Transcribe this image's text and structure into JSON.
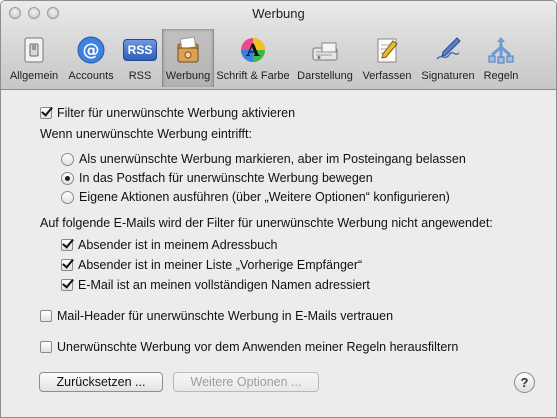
{
  "window": {
    "title": "Werbung"
  },
  "toolbar": {
    "items": [
      {
        "label": "Allgemein",
        "icon": "light-switch-icon"
      },
      {
        "label": "Accounts",
        "icon": "at-sign-icon"
      },
      {
        "label": "RSS",
        "icon": "rss-icon",
        "icon_text": "RSS"
      },
      {
        "label": "Werbung",
        "icon": "junk-mail-icon",
        "selected": true
      },
      {
        "label": "Schrift & Farbe",
        "icon": "font-color-icon",
        "icon_text": "A"
      },
      {
        "label": "Darstellung",
        "icon": "viewing-icon"
      },
      {
        "label": "Verfassen",
        "icon": "composing-icon"
      },
      {
        "label": "Signaturen",
        "icon": "signature-pen-icon"
      },
      {
        "label": "Regeln",
        "icon": "rules-icon"
      }
    ]
  },
  "junk": {
    "enable_label": "Filter für unerwünschte Werbung aktivieren",
    "enable_checked": true,
    "when_label": "Wenn unerwünschte Werbung eintrifft:",
    "options": [
      {
        "label": "Als unerwünschte Werbung markieren, aber im Posteingang belassen",
        "selected": false
      },
      {
        "label": "In das Postfach für unerwünschte Werbung bewegen",
        "selected": true
      },
      {
        "label": "Eigene Aktionen ausführen (über „Weitere Optionen“ konfigurieren)",
        "selected": false
      }
    ],
    "exempt_label": "Auf folgende E-Mails wird der Filter für unerwünschte Werbung nicht angewendet:",
    "exemptions": [
      {
        "label": "Absender ist in meinem Adressbuch",
        "checked": true
      },
      {
        "label": "Absender ist in meiner Liste „Vorherige Empfänger“",
        "checked": true
      },
      {
        "label": "E-Mail ist an meinen vollständigen Namen adressiert",
        "checked": true
      }
    ],
    "trust_headers_label": "Mail-Header für unerwünschte Werbung in E-Mails vertrauen",
    "trust_headers_checked": false,
    "filter_before_rules_label": "Unerwünschte Werbung vor dem Anwenden meiner Regeln herausfiltern",
    "filter_before_rules_checked": false
  },
  "buttons": {
    "reset": "Zurücksetzen ...",
    "advanced": "Weitere Optionen ...",
    "help": "?"
  },
  "colors": {
    "selected_tab_bg": "#b9b9b9",
    "rss_blue": "#3b6fc4",
    "accounts_blue": "#2c6fd0"
  }
}
